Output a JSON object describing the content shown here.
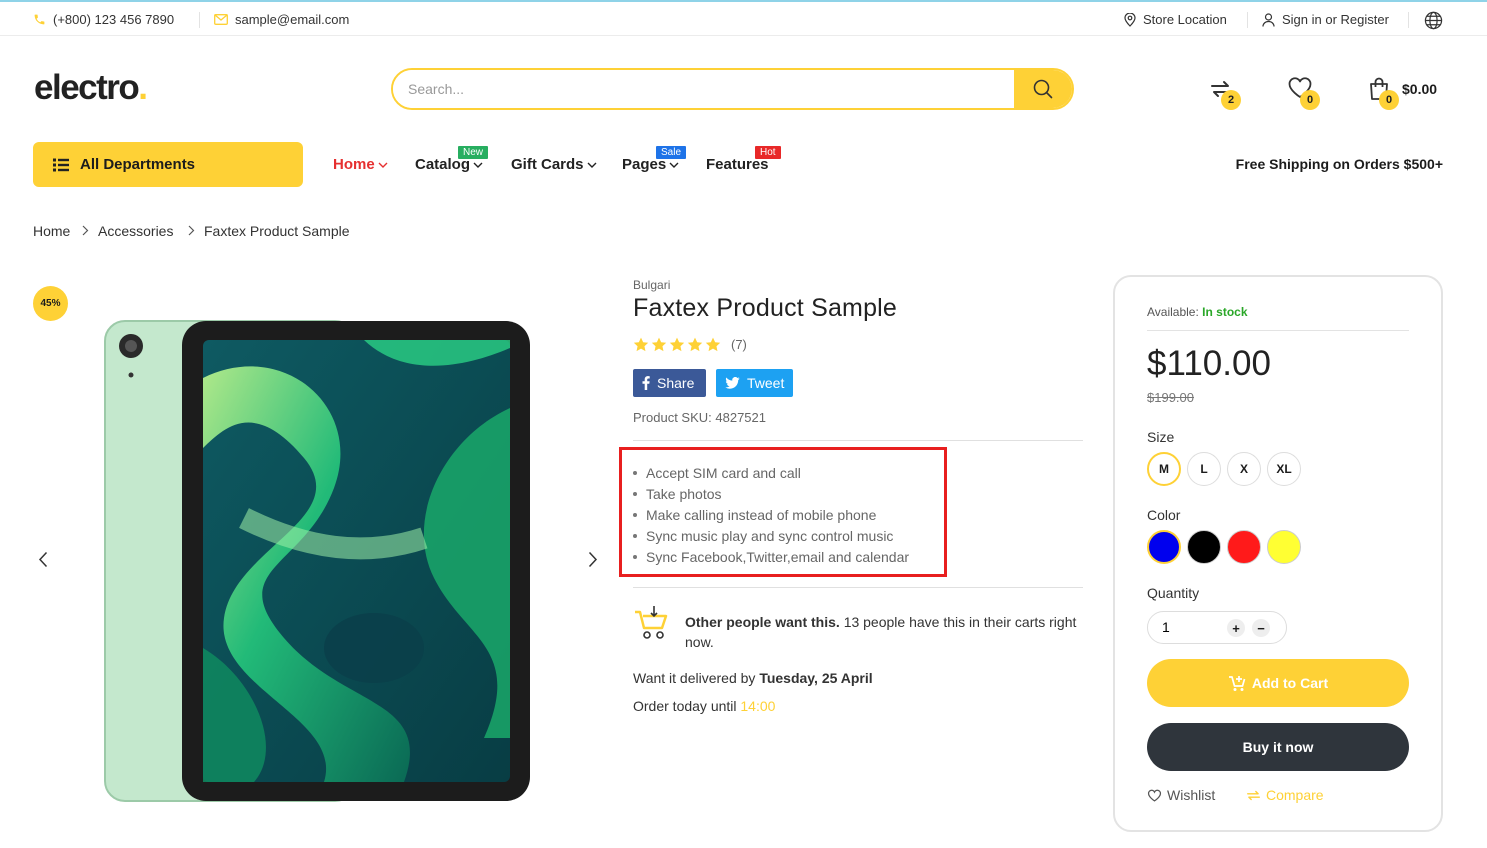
{
  "topbar": {
    "phone": "(+800) 123 456 7890",
    "email": "sample@email.com",
    "store_location": "Store Location",
    "signin": "Sign in or Register"
  },
  "header": {
    "logo_text": "electro",
    "logo_dot": ".",
    "search_placeholder": "Search...",
    "compare_count": "2",
    "wishlist_count": "0",
    "cart_count": "0",
    "cart_total": "$0.00"
  },
  "nav": {
    "all_departments": "All Departments",
    "items": [
      {
        "label": "Home",
        "tag": ""
      },
      {
        "label": "Catalog",
        "tag": "New"
      },
      {
        "label": "Gift Cards",
        "tag": ""
      },
      {
        "label": "Pages",
        "tag": "Sale"
      },
      {
        "label": "Features",
        "tag": "Hot"
      }
    ],
    "free_shipping": "Free Shipping on Orders $500+"
  },
  "breadcrumb": [
    "Home",
    "Accessories",
    "Faxtex Product Sample"
  ],
  "gallery": {
    "discount_badge": "45%"
  },
  "product": {
    "brand": "Bulgari",
    "title": "Faxtex Product Sample",
    "rating": 5,
    "review_count": "(7)",
    "share_label": "Share",
    "tweet_label": "Tweet",
    "sku_label": "Product SKU:",
    "sku": "4827521",
    "features": [
      "Accept SIM card and call",
      "Take photos",
      "Make calling instead of mobile phone",
      "Sync music play and sync control music",
      "Sync Facebook,Twitter,email and calendar"
    ],
    "demand_bold": "Other people want this.",
    "demand_text": "13 people have this in their carts right now.",
    "delivery_prefix": "Want it delivered by",
    "delivery_date": "Tuesday, 25 April",
    "order_prefix": "Order today until",
    "order_time": "14:00"
  },
  "buybox": {
    "available_label": "Available:",
    "available_status": "In stock",
    "price": "$110.00",
    "old_price": "$199.00",
    "size_label": "Size",
    "sizes": [
      "M",
      "L",
      "X",
      "XL"
    ],
    "selected_size": "M",
    "color_label": "Color",
    "colors": [
      "#0000ee",
      "#000000",
      "#ff1a1a",
      "#ffff33"
    ],
    "quantity_label": "Quantity",
    "quantity": "1",
    "plus": "+",
    "minus": "−",
    "add_to_cart": "Add to Cart",
    "buy_now": "Buy it now",
    "wishlist": "Wishlist",
    "compare": "Compare"
  },
  "colors": {
    "accent": "#fed136",
    "sale_red": "#e63030",
    "new_tag": "#27ae60",
    "sale_tag": "#1e73e8",
    "hot_tag": "#e82828",
    "facebook": "#3b5998",
    "twitter": "#1da1f2",
    "in_stock": "#2aa728",
    "dark_button": "#2f353c"
  }
}
